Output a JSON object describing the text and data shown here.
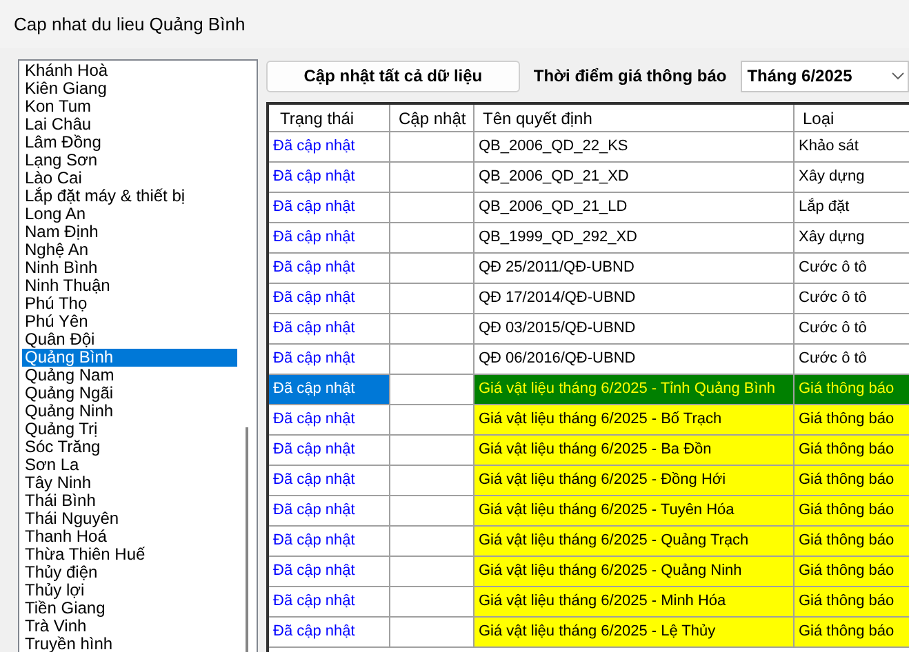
{
  "window": {
    "title": "Cap nhat du lieu Quảng Bình"
  },
  "provinces": [
    {
      "label": "Khánh Hoà",
      "selected": false
    },
    {
      "label": "Kiên Giang",
      "selected": false
    },
    {
      "label": "Kon Tum",
      "selected": false
    },
    {
      "label": "Lai Châu",
      "selected": false
    },
    {
      "label": "Lâm Đồng",
      "selected": false
    },
    {
      "label": "Lạng Sơn",
      "selected": false
    },
    {
      "label": "Lào Cai",
      "selected": false
    },
    {
      "label": "Lắp đặt máy & thiết bị",
      "selected": false
    },
    {
      "label": "Long An",
      "selected": false
    },
    {
      "label": "Nam Định",
      "selected": false
    },
    {
      "label": "Nghệ An",
      "selected": false
    },
    {
      "label": "Ninh Bình",
      "selected": false
    },
    {
      "label": "Ninh Thuận",
      "selected": false
    },
    {
      "label": "Phú Thọ",
      "selected": false
    },
    {
      "label": "Phú Yên",
      "selected": false
    },
    {
      "label": "Quân Đội",
      "selected": false
    },
    {
      "label": "Quảng Bình",
      "selected": true
    },
    {
      "label": "Quảng Nam",
      "selected": false
    },
    {
      "label": "Quảng Ngãi",
      "selected": false
    },
    {
      "label": "Quảng Ninh",
      "selected": false
    },
    {
      "label": "Quảng Trị",
      "selected": false
    },
    {
      "label": "Sóc Trăng",
      "selected": false
    },
    {
      "label": "Sơn La",
      "selected": false
    },
    {
      "label": "Tây Ninh",
      "selected": false
    },
    {
      "label": "Thái Bình",
      "selected": false
    },
    {
      "label": "Thái Nguyên",
      "selected": false
    },
    {
      "label": "Thanh Hoá",
      "selected": false
    },
    {
      "label": "Thừa Thiên Huế",
      "selected": false
    },
    {
      "label": "Thủy điện",
      "selected": false
    },
    {
      "label": "Thủy lợi",
      "selected": false
    },
    {
      "label": "Tiền Giang",
      "selected": false
    },
    {
      "label": "Trà Vinh",
      "selected": false
    },
    {
      "label": "Truyền hình",
      "selected": false
    }
  ],
  "update_all_button": "Cập nhật tất cả dữ liệu",
  "price_time": {
    "label": "Thời điểm giá thông báo",
    "value": "Tháng 6/2025"
  },
  "table": {
    "columns": [
      "Trạng thái",
      "Cập nhật",
      "Tên quyết định",
      "Loại"
    ],
    "rows": [
      {
        "status": "Đã cập nhật",
        "name": "QB_2006_QD_22_KS",
        "type": "Khảo sát",
        "highlighted": false,
        "selected": false
      },
      {
        "status": "Đã cập nhật",
        "name": "QB_2006_QD_21_XD",
        "type": "Xây dựng",
        "highlighted": false,
        "selected": false
      },
      {
        "status": "Đã cập nhật",
        "name": "QB_2006_QD_21_LD",
        "type": "Lắp đặt",
        "highlighted": false,
        "selected": false
      },
      {
        "status": "Đã cập nhật",
        "name": "QB_1999_QD_292_XD",
        "type": "Xây dựng",
        "highlighted": false,
        "selected": false
      },
      {
        "status": "Đã cập nhật",
        "name": "QĐ 25/2011/QĐ-UBND",
        "type": "Cước ô tô",
        "highlighted": false,
        "selected": false
      },
      {
        "status": "Đã cập nhật",
        "name": "QĐ 17/2014/QĐ-UBND",
        "type": "Cước ô tô",
        "highlighted": false,
        "selected": false
      },
      {
        "status": "Đã cập nhật",
        "name": "QĐ 03/2015/QĐ-UBND",
        "type": "Cước ô tô",
        "highlighted": false,
        "selected": false
      },
      {
        "status": "Đã cập nhật",
        "name": "QĐ 06/2016/QĐ-UBND",
        "type": "Cước ô tô",
        "highlighted": false,
        "selected": false
      },
      {
        "status": "Đã cập nhật",
        "name": "Giá vật liệu tháng 6/2025 - Tỉnh Quảng Bình",
        "type": "Giá thông báo",
        "highlighted": true,
        "selected": true
      },
      {
        "status": "Đã cập nhật",
        "name": "Giá vật liệu tháng 6/2025 - Bố Trạch",
        "type": "Giá thông báo",
        "highlighted": true,
        "selected": false
      },
      {
        "status": "Đã cập nhật",
        "name": "Giá vật liệu tháng 6/2025 - Ba Đồn",
        "type": "Giá thông báo",
        "highlighted": true,
        "selected": false
      },
      {
        "status": "Đã cập nhật",
        "name": "Giá vật liệu tháng 6/2025 - Đồng Hới",
        "type": "Giá thông báo",
        "highlighted": true,
        "selected": false
      },
      {
        "status": "Đã cập nhật",
        "name": "Giá vật liệu tháng 6/2025 - Tuyên Hóa",
        "type": "Giá thông báo",
        "highlighted": true,
        "selected": false
      },
      {
        "status": "Đã cập nhật",
        "name": "Giá vật liệu tháng 6/2025 - Quảng Trạch",
        "type": "Giá thông báo",
        "highlighted": true,
        "selected": false
      },
      {
        "status": "Đã cập nhật",
        "name": "Giá vật liệu tháng 6/2025 - Quảng Ninh",
        "type": "Giá thông báo",
        "highlighted": true,
        "selected": false
      },
      {
        "status": "Đã cập nhật",
        "name": "Giá vật liệu tháng 6/2025 - Minh Hóa",
        "type": "Giá thông báo",
        "highlighted": true,
        "selected": false
      },
      {
        "status": "Đã cập nhật",
        "name": "Giá vật liệu tháng 6/2025 - Lệ Thủy",
        "type": "Giá thông báo",
        "highlighted": true,
        "selected": false
      }
    ]
  }
}
